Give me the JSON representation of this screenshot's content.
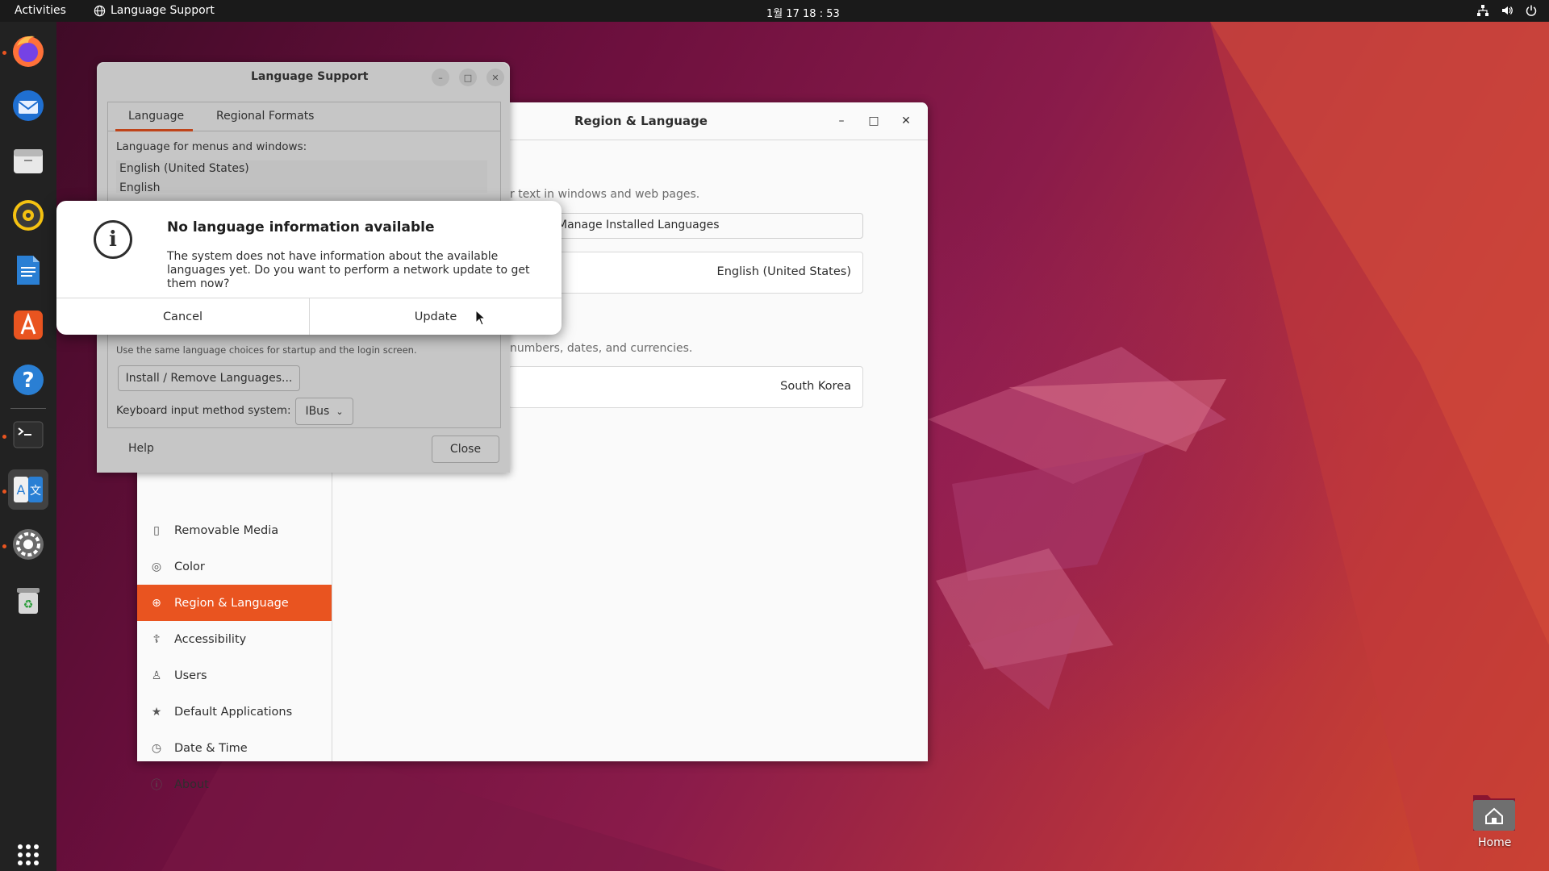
{
  "topbar": {
    "activities": "Activities",
    "app_name": "Language Support",
    "clock": "1월 17  18 : 53"
  },
  "dock": {
    "items": [
      {
        "name": "firefox",
        "running": true
      },
      {
        "name": "thunderbird",
        "running": false
      },
      {
        "name": "files",
        "running": false
      },
      {
        "name": "rhythmbox",
        "running": false
      },
      {
        "name": "libreoffice-writer",
        "running": false
      },
      {
        "name": "app-center",
        "running": false
      },
      {
        "name": "help",
        "running": false
      },
      {
        "name": "terminal",
        "running": true
      },
      {
        "name": "language-support",
        "running": true
      },
      {
        "name": "settings",
        "running": true
      },
      {
        "name": "trash",
        "running": false
      }
    ]
  },
  "settings_window": {
    "title": "Region & Language",
    "language_desc": "r text in windows and web pages.",
    "manage_button": "Manage Installed Languages",
    "language_value": "English (United States)",
    "formats_desc": "numbers, dates, and currencies.",
    "formats_value": "South Korea",
    "sidebar": {
      "items": [
        {
          "label": "Removable Media",
          "icon": "usb-icon",
          "selected": false
        },
        {
          "label": "Color",
          "icon": "color-icon",
          "selected": false
        },
        {
          "label": "Region & Language",
          "icon": "globe-icon",
          "selected": true
        },
        {
          "label": "Accessibility",
          "icon": "accessibility-icon",
          "selected": false
        },
        {
          "label": "Users",
          "icon": "user-icon",
          "selected": false
        },
        {
          "label": "Default Applications",
          "icon": "star-icon",
          "selected": false
        },
        {
          "label": "Date & Time",
          "icon": "clock-icon",
          "selected": false
        },
        {
          "label": "About",
          "icon": "info-icon",
          "selected": false
        }
      ]
    }
  },
  "language_support": {
    "title": "Language Support",
    "tabs": [
      "Language",
      "Regional Formats"
    ],
    "menus_label": "Language for menus and windows:",
    "languages": [
      "English (United States)",
      "English"
    ],
    "startup_note": "Use the same language choices for startup and the login screen.",
    "install_button": "Install / Remove Languages...",
    "keyboard_label": "Keyboard input method system:",
    "keyboard_value": "IBus",
    "help_button": "Help",
    "close_button": "Close"
  },
  "dialog": {
    "title": "No language information available",
    "message": "The system does not have information about the available languages yet. Do you want to perform a network update to get them now?",
    "cancel": "Cancel",
    "update": "Update"
  },
  "desktop": {
    "home_label": "Home"
  },
  "colors": {
    "accent": "#e95420",
    "topbar": "#1a1a1a",
    "dock": "#222222"
  }
}
